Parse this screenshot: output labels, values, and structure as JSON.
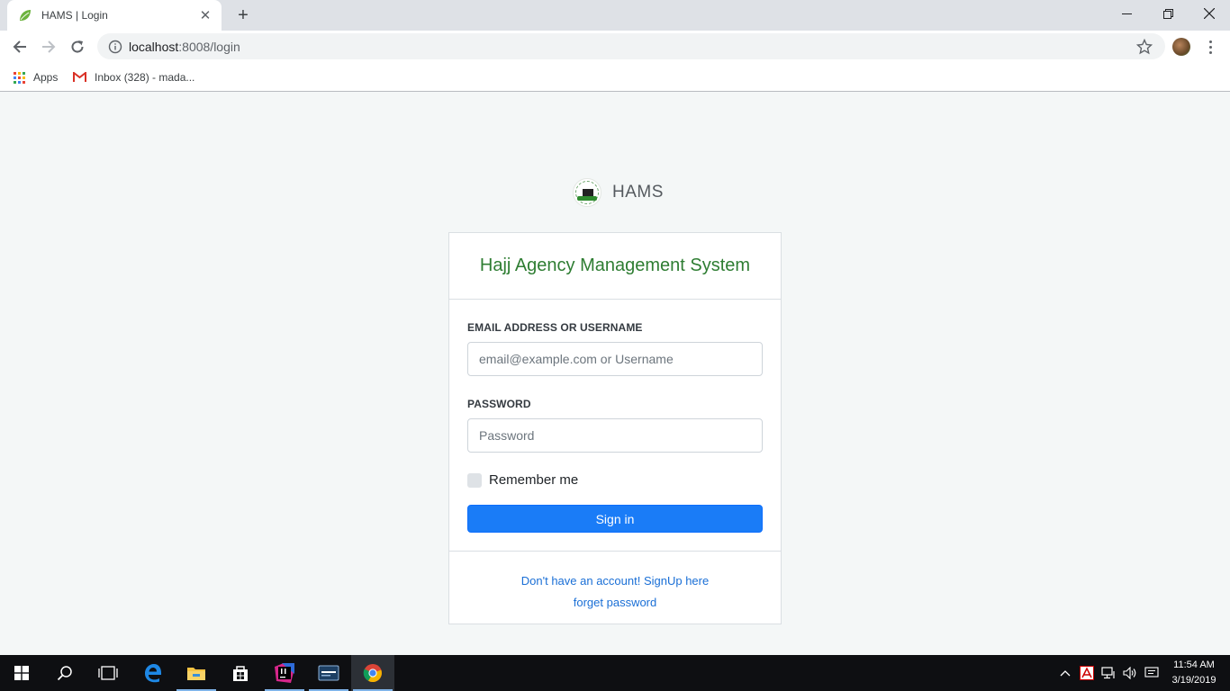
{
  "browser": {
    "tab": {
      "title": "HAMS | Login"
    },
    "address": {
      "host": "localhost",
      "path": ":8008/login"
    },
    "bookmarks": [
      {
        "label": "Apps"
      },
      {
        "label": "Inbox (328) - mada..."
      }
    ]
  },
  "page": {
    "brand_name": "HAMS",
    "card_title": "Hajj Agency Management System",
    "email_label": "EMAIL ADDRESS OR USERNAME",
    "email_placeholder": "email@example.com or Username",
    "password_label": "PASSWORD",
    "password_placeholder": "Password",
    "remember_label": "Remember me",
    "signin_label": "Sign in",
    "signup_link": "Don't have an account! SignUp here",
    "forgot_link": "forget password"
  },
  "taskbar": {
    "time": "11:54 AM",
    "date": "3/19/2019"
  },
  "colors": {
    "accent_green": "#2e7d32",
    "primary_blue": "#1a7cf7",
    "link_blue": "#1a6fd6",
    "page_bg": "#f4f7f7"
  }
}
